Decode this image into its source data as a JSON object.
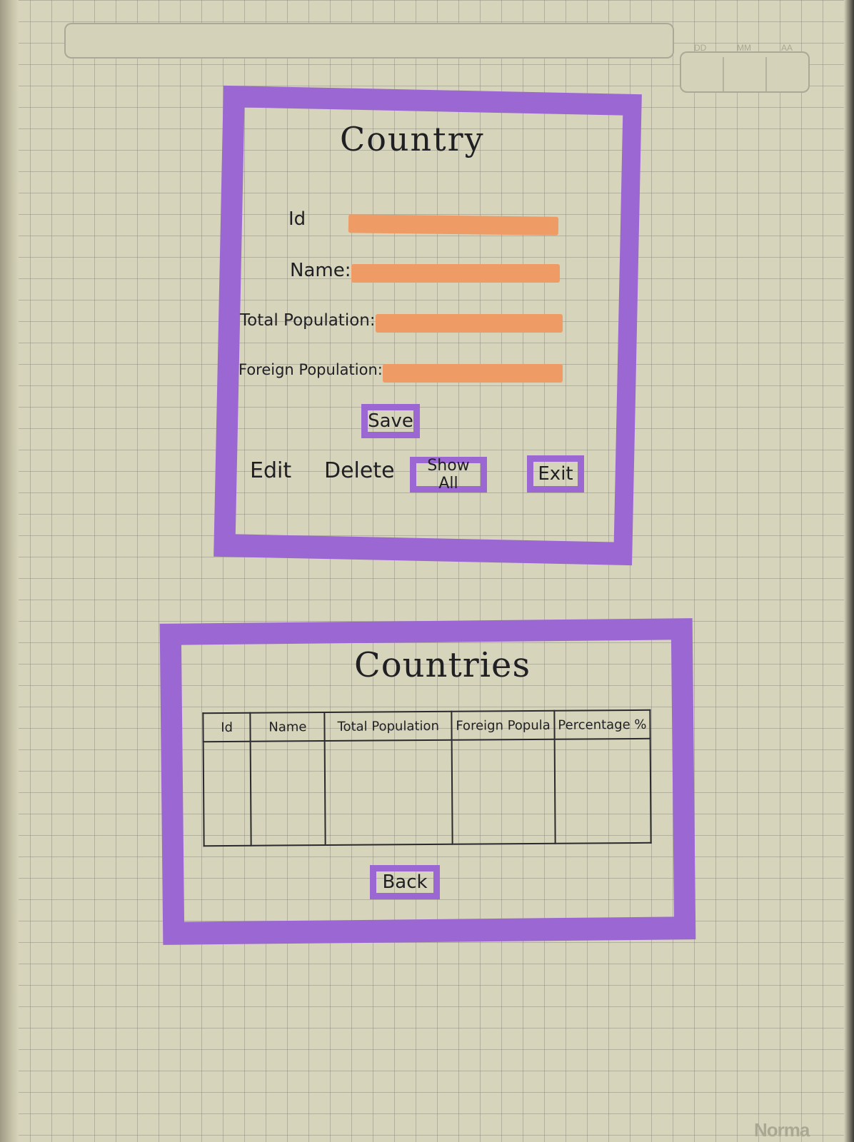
{
  "header": {
    "date_labels": [
      "DD",
      "MM",
      "AA"
    ]
  },
  "brand": "Norma",
  "country_form": {
    "title": "Country",
    "fields": [
      {
        "label": "Id",
        "value": ""
      },
      {
        "label": "Name:",
        "value": ""
      },
      {
        "label": "Total Population:",
        "value": ""
      },
      {
        "label": "Foreign Population:",
        "value": ""
      }
    ],
    "save_label": "Save",
    "edit_label": "Edit",
    "delete_label": "Delete",
    "show_all_label": "Show All",
    "exit_label": "Exit"
  },
  "countries_list": {
    "title": "Countries",
    "columns": [
      "Id",
      "Name",
      "Total Population",
      "Foreign Popula",
      "Percentage %"
    ],
    "rows": [],
    "back_label": "Back"
  },
  "colors": {
    "frame": "#9b67d2",
    "input_fill": "#ee9b65",
    "paper": "#d6d4ba"
  }
}
